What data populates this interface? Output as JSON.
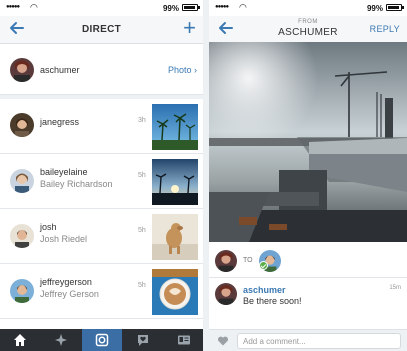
{
  "status": {
    "time": "",
    "battery": "99%"
  },
  "left": {
    "title": "DIRECT",
    "top_row": {
      "username": "aschumer",
      "photo_link": "Photo ›"
    },
    "rows": [
      {
        "username": "janegress",
        "fullname": "",
        "time": "3h"
      },
      {
        "username": "baileyelaine",
        "fullname": "Bailey Richardson",
        "time": "5h"
      },
      {
        "username": "josh",
        "fullname": "Josh Riedel",
        "time": "5h"
      },
      {
        "username": "jeffreygerson",
        "fullname": "Jeffrey Gerson",
        "time": "5h"
      }
    ],
    "tabs": [
      "home-icon",
      "explore-icon",
      "camera-icon",
      "activity-icon",
      "profile-icon"
    ]
  },
  "right": {
    "from_label": "FROM",
    "from_name": "ASCHUMER",
    "reply_label": "REPLY",
    "to_label": "TO",
    "comment": {
      "username": "aschumer",
      "text": "Be there soon!",
      "time": "15m"
    },
    "compose_placeholder": "Add a comment..."
  },
  "colors": {
    "accent": "#3b79b3",
    "tabbar": "#2b2f33",
    "tab_active": "#3b6ea5"
  }
}
